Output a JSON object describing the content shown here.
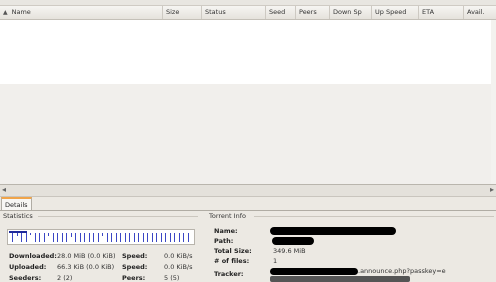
{
  "columns": {
    "name": "Name",
    "size": "Size",
    "status": "Status",
    "seed": "Seed",
    "peers": "Peers",
    "down_speed": "Down Sp",
    "up_speed": "Up Speed",
    "eta": "ETA",
    "avail": "Avail."
  },
  "details": {
    "tab": "Details",
    "statistics": {
      "title": "Statistics",
      "downloaded_label": "Downloaded:",
      "downloaded_value": "28.0 MiB (0.0 KiB)",
      "uploaded_label": "Uploaded:",
      "uploaded_value": "66.3 KiB (0.0 KiB)",
      "seeders_label": "Seeders:",
      "seeders_value": "2 (2)",
      "speed_label": "Speed:",
      "down_speed_value": "0.0 KiB/s",
      "up_speed_value": "0.0 KiB/s",
      "peers_label": "Peers:",
      "peers_value": "5 (5)"
    },
    "torrent_info": {
      "title": "Torrent Info",
      "name_label": "Name:",
      "path_label": "Path:",
      "total_size_label": "Total Size:",
      "total_size_value": "349.6 MiB",
      "files_label": "# of files:",
      "files_value": "1",
      "tracker_label": "Tracker:",
      "tracker_value": ".announce.php?passkey=e"
    }
  },
  "colors": {
    "accent": "#f0a44a",
    "graph_line": "#3b47c4"
  }
}
